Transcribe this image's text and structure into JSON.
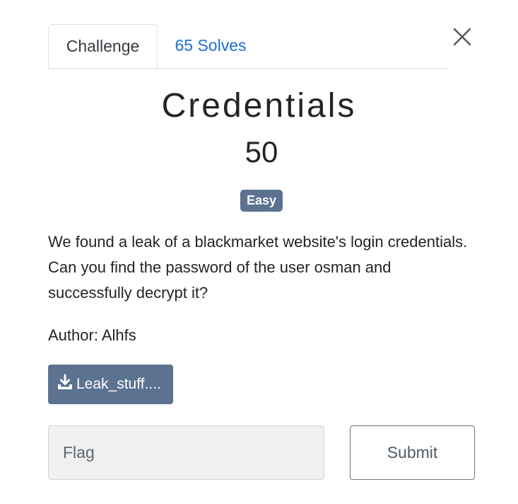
{
  "tabs": {
    "challenge_label": "Challenge",
    "solves_label": "65 Solves"
  },
  "challenge": {
    "title": "Credentials",
    "points": "50",
    "difficulty_badge": "Easy",
    "description": "We found a leak of a blackmarket website's login credentials. Can you find the password of the user osman and successfully decrypt it?",
    "author": "Author: Alhfs"
  },
  "file": {
    "label": "Leak_stuff....",
    "icon": "download-icon"
  },
  "form": {
    "flag_placeholder": "Flag",
    "flag_value": "",
    "submit_label": "Submit"
  },
  "icons": {
    "close": "close-icon"
  },
  "colors": {
    "accent_link": "#1b6fd8",
    "badge_bg": "#5b7290",
    "file_button_bg": "#5b7290"
  }
}
